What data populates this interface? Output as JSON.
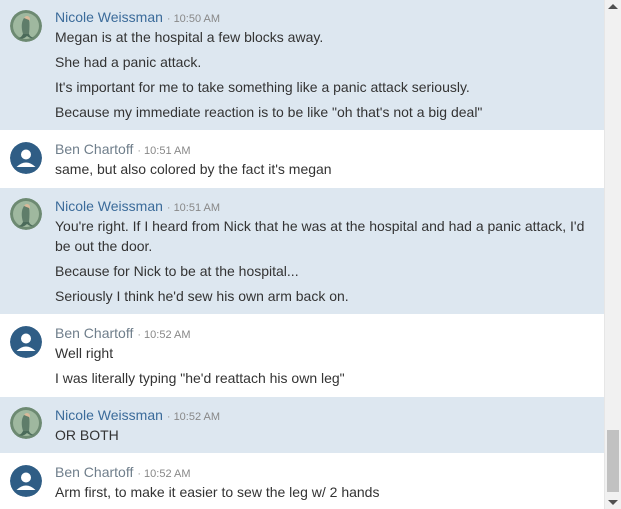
{
  "colors": {
    "highlight_row": "#dde7f0",
    "nicole_name": "#3b6b9a",
    "ben_name": "#6f7e8b",
    "ben_avatar": "#2f5d85"
  },
  "messages": [
    {
      "sender": "Nicole Weissman",
      "time": "10:50 AM",
      "avatar": "mermaid-avatar",
      "lines": [
        "Megan is at the hospital a few blocks away.",
        "She had a panic attack.",
        "It's important for me to take something like a panic attack seriously.",
        "Because my immediate reaction is to be like \"oh that's not a big deal\""
      ]
    },
    {
      "sender": "Ben Chartoff",
      "time": "10:51 AM",
      "avatar": "default-user-avatar",
      "lines": [
        "same, but also colored by the fact it's megan"
      ]
    },
    {
      "sender": "Nicole Weissman",
      "time": "10:51 AM",
      "avatar": "mermaid-avatar",
      "lines": [
        "You're right. If I heard from Nick that he was at the hospital and had a panic attack, I'd be out the door.",
        "Because for Nick to be at the hospital...",
        "Seriously I think he'd sew his own arm back on."
      ]
    },
    {
      "sender": "Ben Chartoff",
      "time": "10:52 AM",
      "avatar": "default-user-avatar",
      "lines": [
        "Well right",
        "I was literally typing \"he'd reattach his own leg\""
      ]
    },
    {
      "sender": "Nicole Weissman",
      "time": "10:52 AM",
      "avatar": "mermaid-avatar",
      "lines": [
        "OR BOTH"
      ]
    },
    {
      "sender": "Ben Chartoff",
      "time": "10:52 AM",
      "avatar": "default-user-avatar",
      "lines": [
        "Arm first, to make it easier to sew the leg w/ 2 hands"
      ]
    }
  ]
}
